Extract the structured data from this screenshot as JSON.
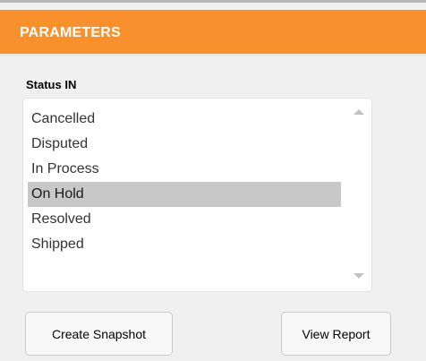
{
  "panel": {
    "title": "PARAMETERS"
  },
  "status_filter": {
    "label": "Status IN",
    "options": [
      "Cancelled",
      "Disputed",
      "In Process",
      "On Hold",
      "Resolved",
      "Shipped"
    ],
    "selected": "On Hold"
  },
  "actions": {
    "create_snapshot": "Create Snapshot",
    "view_report": "View Report"
  },
  "icons": {
    "scroll_up": "scroll-up-arrow",
    "scroll_down": "scroll-down-arrow"
  },
  "colors": {
    "header": "#f7902d",
    "selected_row": "#c8c8c8"
  }
}
